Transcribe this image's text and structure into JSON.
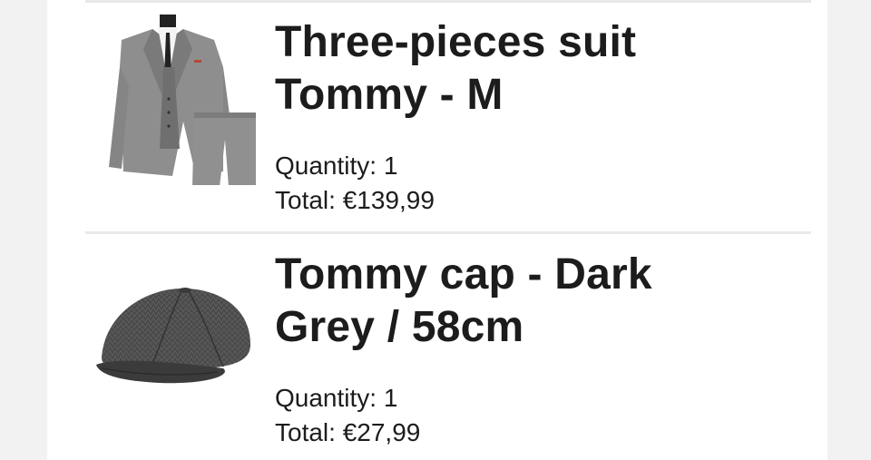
{
  "cart": {
    "items": [
      {
        "title_line1": "Three-pieces suit",
        "title_line2": "Tommy - M",
        "quantity_label": "Quantity: 1",
        "total_label": "Total: €139,99",
        "image_icon": "three-piece-suit-image"
      },
      {
        "title_line1": "Tommy cap - Dark",
        "title_line2": "Grey / 58cm",
        "quantity_label": "Quantity: 1",
        "total_label": "Total: €27,99",
        "image_icon": "flat-cap-image"
      }
    ]
  },
  "colors": {
    "text": "#1c1c1c",
    "divider": "#e9e9e9",
    "background": "#f2f2f2",
    "card": "#ffffff"
  }
}
